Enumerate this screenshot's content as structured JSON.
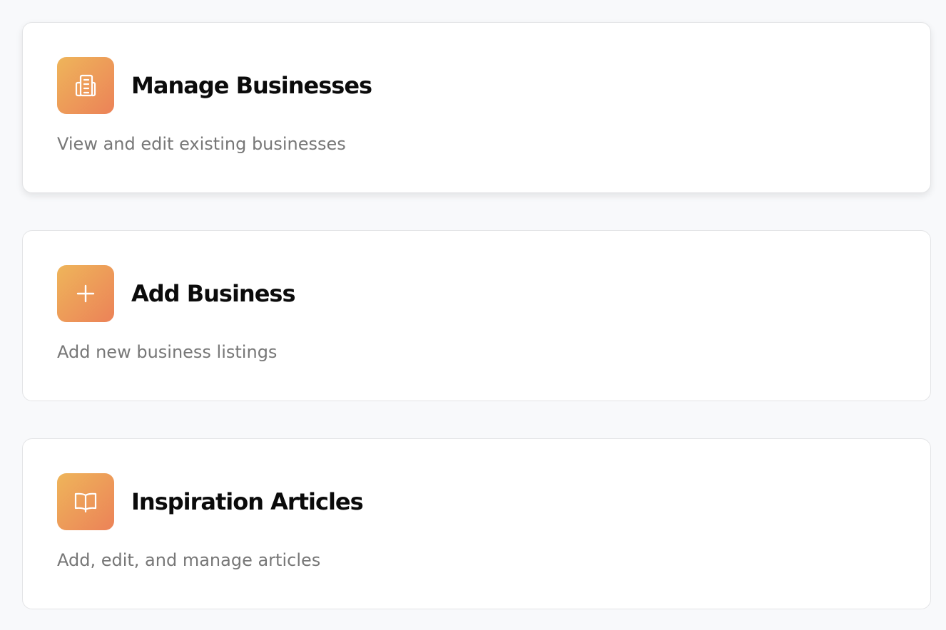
{
  "colors": {
    "page_background": "#f8f9fb",
    "card_background": "#ffffff",
    "card_border": "#e3e4e6",
    "icon_gradient_start": "#eeb55a",
    "icon_gradient_end": "#ec8258",
    "title_text": "#0b0b0b",
    "description_text": "#777777"
  },
  "cards": [
    {
      "icon": "building-icon",
      "title": "Manage Businesses",
      "description": "View and edit existing businesses",
      "hovered": true
    },
    {
      "icon": "plus-icon",
      "title": "Add Business",
      "description": "Add new business listings",
      "hovered": false
    },
    {
      "icon": "open-book-icon",
      "title": "Inspiration Articles",
      "description": "Add, edit, and manage articles",
      "hovered": false
    }
  ]
}
